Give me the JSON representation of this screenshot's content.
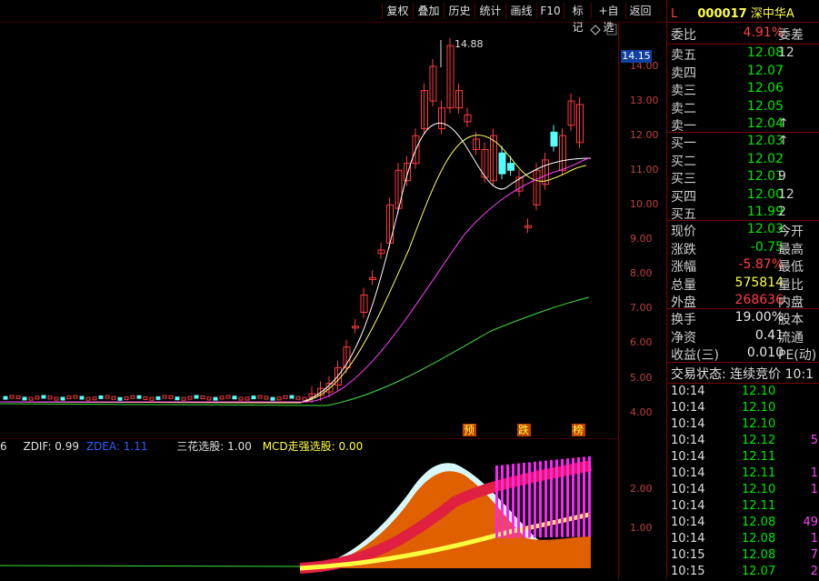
{
  "toolbar": {
    "buttons": [
      "复权",
      "叠加",
      "历史",
      "统计",
      "画线",
      "F10",
      "标记",
      "+自选",
      "返回"
    ]
  },
  "chart": {
    "high_label": "14.88",
    "price_axis": [
      "14.00",
      "13.00",
      "12.00",
      "11.00",
      "10.00",
      "9.00",
      "8.00",
      "7.00",
      "6.00",
      "5.00",
      "4.00"
    ],
    "current_price_tag": "14.15",
    "markers": [
      "预",
      "跌",
      "榜"
    ],
    "sub_axis": [
      "2.00",
      "1.00"
    ]
  },
  "indicator": {
    "prefix": "6",
    "zdif": "ZDIF: 0.99",
    "zdea": "ZDEA: 1.11",
    "sanhua": "三花选股: 1.00",
    "mcd": "MCD走强选股: 0.00"
  },
  "quote": {
    "header_mark": "L",
    "code": "000017",
    "name": "深中华A",
    "weibi_label": "委比",
    "weibi_value": "4.91%",
    "weicha_label": "委差",
    "sell": [
      {
        "label": "卖五",
        "price": "12.08",
        "vol": "12"
      },
      {
        "label": "卖四",
        "price": "12.07",
        "vol": ""
      },
      {
        "label": "卖三",
        "price": "12.06",
        "vol": ""
      },
      {
        "label": "卖二",
        "price": "12.05",
        "vol": ""
      },
      {
        "label": "卖一",
        "price": "12.04",
        "vol": "↑"
      }
    ],
    "buy": [
      {
        "label": "买一",
        "price": "12.03",
        "vol": "↑"
      },
      {
        "label": "买二",
        "price": "12.02",
        "vol": ""
      },
      {
        "label": "买三",
        "price": "12.01",
        "vol": "9"
      },
      {
        "label": "买四",
        "price": "12.00",
        "vol": "12"
      },
      {
        "label": "买五",
        "price": "11.99",
        "vol": "2"
      }
    ],
    "stats": [
      {
        "label": "现价",
        "value": "12.03",
        "ext": "今开"
      },
      {
        "label": "涨跌",
        "value": "-0.75",
        "ext": "最高"
      },
      {
        "label": "涨幅",
        "value": "-5.87%",
        "ext": "最低"
      },
      {
        "label": "总量",
        "value": "575814",
        "ext": "量比"
      },
      {
        "label": "外盘",
        "value": "268636",
        "ext": "内盘"
      }
    ],
    "stats2": [
      {
        "label": "换手",
        "value": "19.00%",
        "ext": "股本"
      },
      {
        "label": "净资",
        "value": "0.41",
        "ext": "流通"
      },
      {
        "label": "收益(三)",
        "value": "0.010",
        "ext": "PE(动)"
      }
    ],
    "status_label": "交易状态: 连续竞价 10:1"
  },
  "ticks": [
    {
      "t": "10:14",
      "p": "12.10",
      "v": "",
      "c": "green"
    },
    {
      "t": "10:14",
      "p": "12.10",
      "v": "",
      "c": "green"
    },
    {
      "t": "10:14",
      "p": "12.10",
      "v": "",
      "c": "green"
    },
    {
      "t": "10:14",
      "p": "12.12",
      "v": "5",
      "c": "green"
    },
    {
      "t": "10:14",
      "p": "12.11",
      "v": "",
      "c": "green"
    },
    {
      "t": "10:14",
      "p": "12.11",
      "v": "1",
      "c": "green"
    },
    {
      "t": "10:14",
      "p": "12.10",
      "v": "1",
      "c": "green"
    },
    {
      "t": "10:14",
      "p": "12.11",
      "v": "",
      "c": "green"
    },
    {
      "t": "10:14",
      "p": "12.08",
      "v": "49",
      "c": "green"
    },
    {
      "t": "10:14",
      "p": "12.08",
      "v": "1",
      "c": "green"
    },
    {
      "t": "10:15",
      "p": "12.08",
      "v": "7",
      "c": "green"
    },
    {
      "t": "10:15",
      "p": "12.07",
      "v": "2",
      "c": "green"
    }
  ],
  "colors": {
    "up": "#ff3c3c",
    "down": "#54ffff",
    "accent": "#ffff40"
  }
}
